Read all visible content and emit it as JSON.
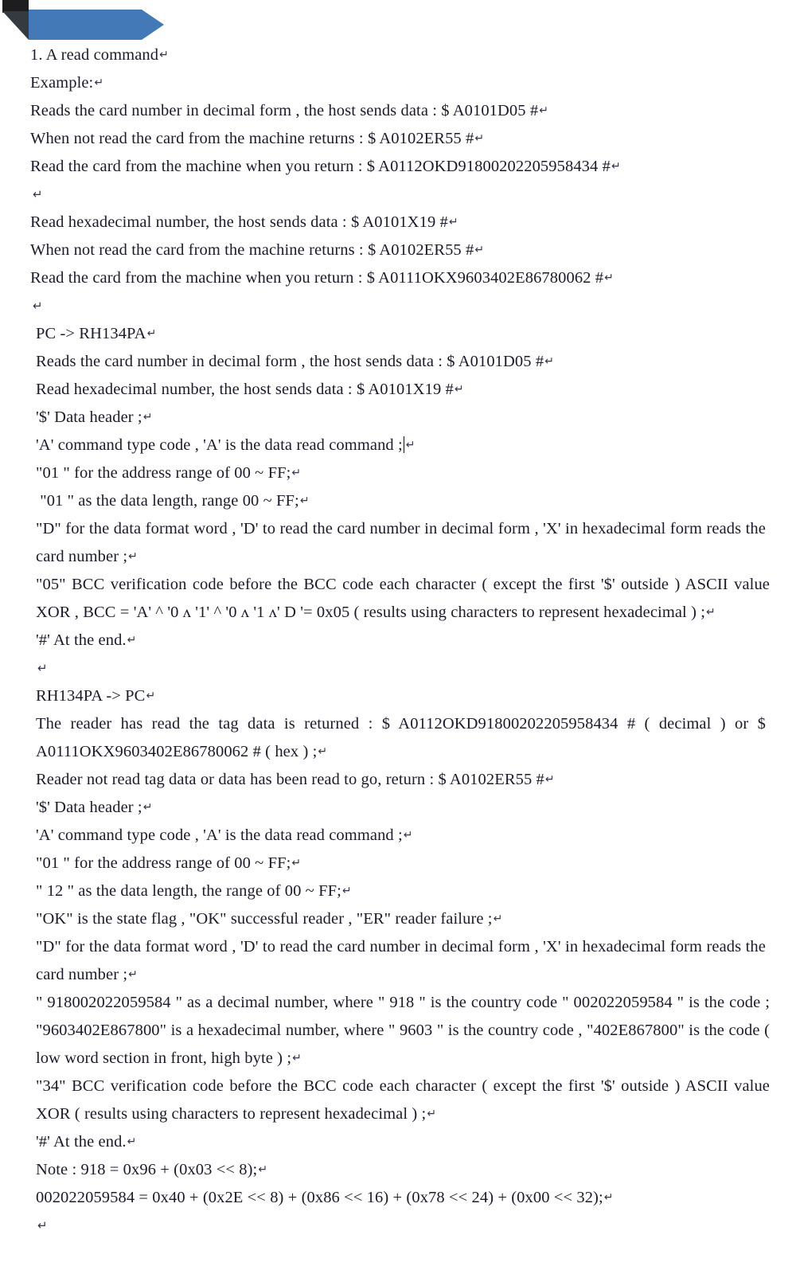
{
  "banner": {
    "accent_color": "#4279b6",
    "corner_color": "#1d1d1d",
    "fold_color": "#343a40",
    "shape": "right-arrow-banner"
  },
  "document": {
    "pilcrow": "↵",
    "heading": "1. A read command",
    "example_label": "Example:",
    "blocks": [
      {
        "id": "decimal-example",
        "lines": [
          "Reads the card number in decimal form , the host sends data : $ A0101D05 #",
          "When not read the card from the machine returns : $ A0102ER55 #",
          "Read the card from the machine when you return : $ A0112OKD91800202205958434 #"
        ]
      },
      {
        "id": "hex-example",
        "lines": [
          "Read hexadecimal number, the host sends data : $ A0101X19 #",
          "When not read the card from the machine returns : $ A0102ER55 #",
          "Read the card from the machine when you return : $ A0111OKX9603402E86780062 #"
        ]
      }
    ],
    "pc_to_reader": {
      "title": "PC -> RH134PA",
      "lines": [
        "Reads the card number in decimal form , the host sends data : $ A0101D05 #",
        "Read hexadecimal number, the host sends data : $ A0101X19 #"
      ],
      "fields": [
        "'$' Data header ;",
        "'A' command type code , 'A' is the data read command ;",
        "\"01 \" for the address range of 00 ~ FF;",
        " \"01 \" as the data length, range 00 ~ FF;"
      ],
      "format_word": "\"D\" for the data format word , 'D' to read the card number in decimal form , 'X' in hexadecimal form reads the card number ;",
      "bcc": "\"05\" BCC verification code before the BCC code each character ( except the first '$' outside ) ASCII value XOR , BCC = 'A' ^ '0 ʌ '1' ^ '0 ʌ '1 ʌ' D '= 0x05 ( results using characters to represent hexadecimal ) ;",
      "end": "'#' At the end."
    },
    "reader_to_pc": {
      "title": "RH134PA -> PC",
      "returned": "The reader has read the tag data is returned : $ A0112OKD91800202205958434 # ( decimal ) or $ A0111OKX9603402E86780062 # ( hex ) ;",
      "not_read": "Reader not read tag data or data has been read to go, return : $ A0102ER55 #",
      "fields": [
        "'$' Data header ;",
        "'A' command type code , 'A' is the data read command ;",
        "\"01 \" for the address range of 00 ~ FF;",
        "\" 12 \" as the data length, the range of 00 ~ FF;",
        "\"OK\" is the state flag , \"OK\" successful reader , \"ER\" reader failure ;"
      ],
      "format_word": "\"D\" for the data format word , 'D' to read the card number in decimal form , 'X' in hexadecimal form reads the card number ;",
      "number_explain": "\" 918002022059584 \" as a decimal number, where \" 918 \" is the country code \" 002022059584 \" is the code ; \"9603402E867800\" is a hexadecimal number, where \" 9603 \" is the country code , \"402E867800\" is the code ( low word section in front, high byte ) ;",
      "bcc": "\"34\" BCC verification code before the BCC code each character ( except the first '$' outside ) ASCII value XOR ( results using characters to represent hexadecimal ) ;",
      "end": "'#' At the end.",
      "notes": [
        "Note : 918 = 0x96 + (0x03 << 8);",
        "002022059584 = 0x40 + (0x2E << 8) + (0x86 << 16) + (0x78 << 24) + (0x00 << 32);"
      ]
    }
  }
}
